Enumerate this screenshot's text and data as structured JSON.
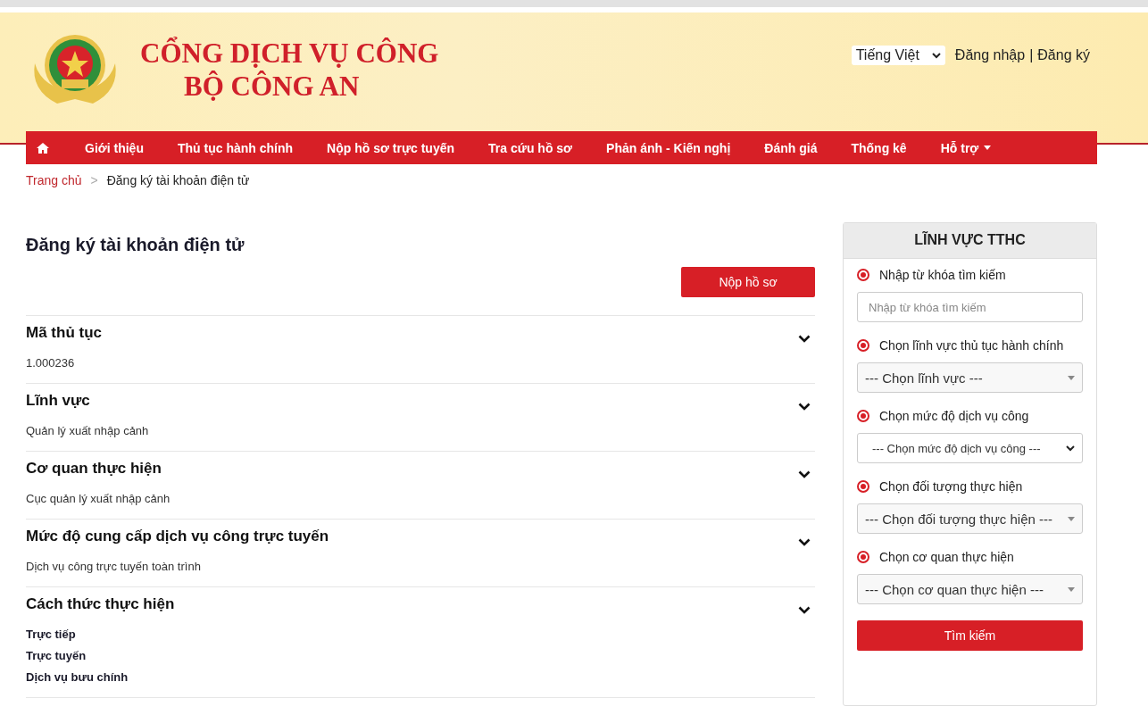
{
  "header": {
    "title_line1": "CỔNG DỊCH VỤ CÔNG",
    "title_line2": "BỘ CÔNG AN",
    "language": "Tiếng Việt",
    "login": "Đăng nhập",
    "separator": "|",
    "register": "Đăng ký"
  },
  "nav": {
    "items": [
      {
        "label": "Giới thiệu",
        "dropdown": false
      },
      {
        "label": "Thủ tục hành chính",
        "dropdown": false
      },
      {
        "label": "Nộp hồ sơ trực tuyến",
        "dropdown": false
      },
      {
        "label": "Tra cứu hồ sơ",
        "dropdown": false
      },
      {
        "label": "Phản ánh - Kiến nghị",
        "dropdown": false
      },
      {
        "label": "Đánh giá",
        "dropdown": false
      },
      {
        "label": "Thống kê",
        "dropdown": false
      },
      {
        "label": "Hỗ trợ",
        "dropdown": true
      }
    ]
  },
  "breadcrumb": {
    "home": "Trang chủ",
    "separator": ">",
    "current": "Đăng ký tài khoản điện tử"
  },
  "page_title": "Đăng ký tài khoản điện tử",
  "submit_button": "Nộp hồ sơ",
  "sections": [
    {
      "title": "Mã thủ tục",
      "bold_values": false,
      "values": [
        "1.000236"
      ]
    },
    {
      "title": "Lĩnh vực",
      "bold_values": false,
      "values": [
        "Quản lý xuất nhập cảnh"
      ]
    },
    {
      "title": "Cơ quan thực hiện",
      "bold_values": false,
      "values": [
        "Cục quản lý xuất nhập cảnh"
      ]
    },
    {
      "title": "Mức độ cung cấp dịch vụ công trực tuyến",
      "bold_values": false,
      "values": [
        "Dịch vụ công trực tuyến toàn trình"
      ]
    },
    {
      "title": "Cách thức thực hiện",
      "bold_values": true,
      "values": [
        "Trực tiếp",
        "Trực tuyến",
        "Dịch vụ bưu chính"
      ]
    }
  ],
  "sidebar": {
    "title": "LĨNH VỰC TTHC",
    "filters": [
      {
        "label": "Nhập từ khóa tìm kiếm",
        "checked": true,
        "kind": "text",
        "placeholder": "Nhập từ khóa tìm kiếm"
      },
      {
        "label": "Chọn lĩnh vực thủ tục hành chính",
        "checked": true,
        "kind": "styled-select",
        "value": "--- Chọn lĩnh vực ---"
      },
      {
        "label": "Chọn mức độ dịch vụ công",
        "checked": true,
        "kind": "native-select",
        "value": "--- Chọn mức độ dịch vụ công ---"
      },
      {
        "label": "Chọn đối tượng thực hiện",
        "checked": true,
        "kind": "styled-select",
        "value": "--- Chọn đối tượng thực hiện ---"
      },
      {
        "label": "Chọn cơ quan thực hiện",
        "checked": true,
        "kind": "styled-select",
        "value": "--- Chọn cơ quan thực hiện ---"
      }
    ],
    "search_button": "Tìm kiếm"
  }
}
